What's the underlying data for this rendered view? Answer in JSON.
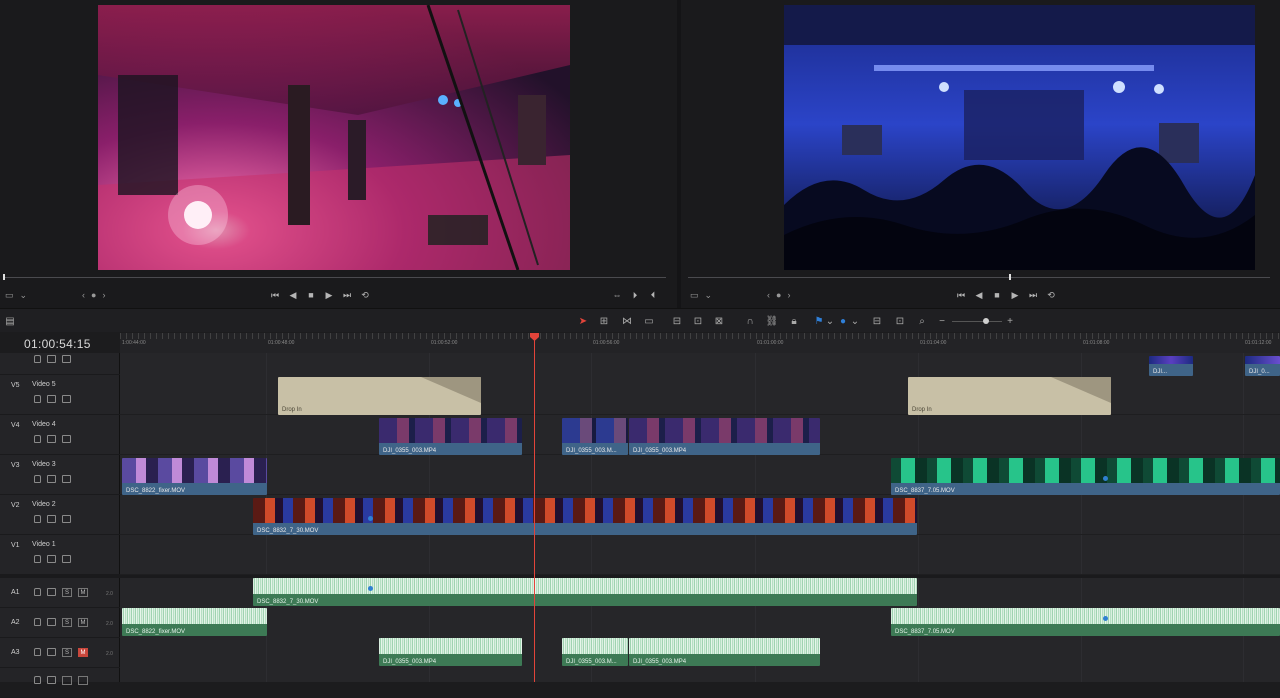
{
  "timeline": {
    "timecode": "01:00:54:15",
    "ruler_labels": [
      "1:00:44:00",
      "01:00:48:00",
      "01:00:52:00",
      "01:00:56:00",
      "01:01:00:00",
      "01:01:04:00",
      "01:01:08:00",
      "01:01:12:00"
    ]
  },
  "tracks": {
    "video": [
      {
        "id": "V5",
        "name": "Video 5"
      },
      {
        "id": "V4",
        "name": "Video 4"
      },
      {
        "id": "V3",
        "name": "Video 3"
      },
      {
        "id": "V2",
        "name": "Video 2"
      },
      {
        "id": "V1",
        "name": "Video 1"
      }
    ],
    "audio": [
      {
        "id": "A1",
        "level": "2.0",
        "solo": "S",
        "mute": "M"
      },
      {
        "id": "A2",
        "level": "2.0",
        "solo": "S",
        "mute": "M"
      },
      {
        "id": "A3",
        "level": "2.0",
        "solo": "S",
        "mute": "M"
      }
    ]
  },
  "clips": {
    "title_a": "Drop In",
    "title_b": "Drop In",
    "v4_a": "DJI_0355_003.MP4",
    "v4_b": "DJI_0355_003.M...",
    "v4_c": "DJI_0355_003.MP4",
    "v3_a": "DSC_8822_fixer.MOV",
    "v3_b": "DSC_8837_7.05.MOV",
    "v2_a": "DSC_8832_7_30.MOV",
    "v6_a": "DJI...",
    "v6_b": "DJI_0...",
    "a1_a": "DSC_8832_7_30.MOV",
    "a2_a": "DSC_8822_fixer.MOV",
    "a2_b": "DSC_8837_7.05.MOV",
    "a3_a": "DJI_0355_003.MP4",
    "a3_b": "DJI_0355_003.M...",
    "a3_c": "DJI_0355_003.MP4"
  },
  "colors": {
    "playhead": "#e2443a",
    "video_clip_bar": "#3f6488",
    "audio_clip": "#3d7a55",
    "title_clip": "#c8c0a6",
    "marker": "#2f80d1"
  }
}
